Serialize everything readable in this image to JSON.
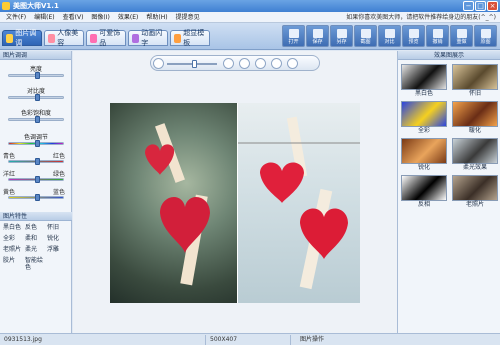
{
  "window": {
    "title": "美图大师V1.1",
    "buttons": [
      "−",
      "□",
      "×"
    ]
  },
  "menubar": {
    "items": [
      "文件(F)",
      "编辑(E)",
      "查看(V)",
      "图像(I)",
      "效果(E)",
      "帮助(H)",
      "提提意见"
    ],
    "promo": "如果你喜欢美图大师，请把软件推荐给身边的朋友(^_^)"
  },
  "tabs": [
    {
      "label": "图片调调",
      "color": "#ffd24a",
      "active": true
    },
    {
      "label": "人像美容",
      "color": "#ff8fa3",
      "active": false
    },
    {
      "label": "可爱饰品",
      "color": "#ff6fb1",
      "active": false
    },
    {
      "label": "动画闪字",
      "color": "#b06fe0",
      "active": false
    },
    {
      "label": "超显模板",
      "color": "#ff9f40",
      "active": false
    }
  ],
  "toolbar": [
    "打开",
    "保存",
    "另存",
    "截图",
    "对比",
    "预览",
    "撤销",
    "重做",
    "原图"
  ],
  "left_panel": {
    "header": "图片调调",
    "sliders": [
      {
        "label": "亮度",
        "value": 0.5
      },
      {
        "label": "对比度",
        "value": 0.5
      },
      {
        "label": "色彩饱和度",
        "value": 0.5
      },
      {
        "label": "色调调节",
        "value": 0.5
      },
      {
        "label": "",
        "left": "青色",
        "right": "红色",
        "value": 0.5
      },
      {
        "label": "",
        "left": "洋红",
        "right": "绿色",
        "value": 0.5
      },
      {
        "label": "",
        "left": "黄色",
        "right": "蓝色",
        "value": 0.5
      }
    ],
    "effects_header": "图片特性",
    "effects": [
      "黑白色",
      "反色",
      "怀旧",
      "全彩",
      "柔和",
      "锐化",
      "老照片",
      "柔光",
      "浮雕",
      "胶片",
      "智能绘色",
      ""
    ]
  },
  "zoom": {
    "value": 0.55
  },
  "right_panel": {
    "header": "效果图展示",
    "thumbs": [
      {
        "label": "黑白色",
        "colors": [
          "#e6e6e6",
          "#111111"
        ]
      },
      {
        "label": "怀旧",
        "colors": [
          "#d9c49a",
          "#5a4a2e"
        ]
      },
      {
        "label": "全彩",
        "colors": [
          "#2a44e0",
          "#f5d020"
        ]
      },
      {
        "label": "暖化",
        "colors": [
          "#f4a24a",
          "#6a2d16"
        ]
      },
      {
        "label": "锐化",
        "colors": [
          "#7a3a16",
          "#e9a45c"
        ]
      },
      {
        "label": "柔光效果",
        "colors": [
          "#c9d2d8",
          "#3a3a3a"
        ]
      },
      {
        "label": "反相",
        "colors": [
          "#ffffff",
          "#000000"
        ]
      },
      {
        "label": "老照片",
        "colors": [
          "#b5a48f",
          "#3b2f27"
        ]
      }
    ]
  },
  "status": {
    "filename": "0931513.jpg",
    "size": "500X407",
    "mode": "图片操作"
  }
}
